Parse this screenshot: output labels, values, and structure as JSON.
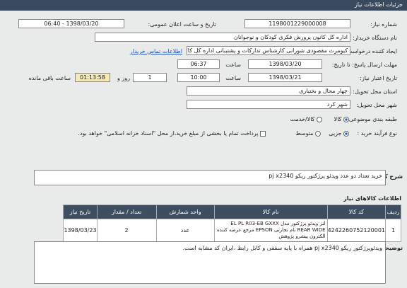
{
  "header": {
    "title": "جزئیات اطلاعات نیاز"
  },
  "labels": {
    "need_no": "شماره نیاز:",
    "public_date": "تاریخ و ساعت اعلان عمومی:",
    "buyer": "نام دستگاه خریدار:",
    "creator": "ایجاد کننده درخواست:",
    "reply_deadline": "مهلت ارسال پاسخ: تا تاریخ:",
    "time": "ساعت",
    "validity": "تاریخ اعتبار نیاز:",
    "day_and": "روز و",
    "remaining": "ساعت باقی مانده",
    "province": "استان محل تحویل:",
    "city": "شهر محل تحویل:",
    "category": "طبقه بندی موضوعی:",
    "process_type": "نوع فرآیند خرید :",
    "contact": "اطلاعات تماس خریدار"
  },
  "values": {
    "need_no": "1198001229000008",
    "public_date": "1398/03/20 - 06:40",
    "buyer": "اداره کل کانون پرورش فکری کودکان و نوجوانان",
    "creator": "کیومرث مقصودی شورانی کارشناس تدارکات و پشتیبانی اداره کل کانون پرورش",
    "reply_date": "1398/03/20",
    "reply_time": "06:37",
    "validity_date": "1398/03/21",
    "validity_time": "10:00",
    "days": "1",
    "remaining": "01:13:58",
    "province": "چهار محال و بختیاری",
    "city": "شهر کرد"
  },
  "category": {
    "options": [
      "کالا",
      "کالا/خدمت"
    ],
    "selected": "کالا"
  },
  "process": {
    "options": [
      "جزیی",
      "متوسط"
    ],
    "selected": "جزیی",
    "note": "پرداخت تمام یا بخشی از مبلغ خرید،از محل \"اسناد خزانه اسلامی\" خواهد بود."
  },
  "general": {
    "title": "شرح کلی نیاز:",
    "text": "خرید تعداد دو عدد ویدئو پرژکتور ریکو pj x2340"
  },
  "goods": {
    "title": "اطلاعات کالاهای نیاز",
    "headers": [
      "ردیف",
      "کد کالا",
      "نام کالا",
      "واحد شمارش",
      "تعداد / مقدار",
      "تاریخ نیاز"
    ],
    "rows": [
      {
        "row": "1",
        "code": "4242260752120001",
        "name": "لنز ویدئو پرژکتور مدل EL PL R03-EB GXXX REAR WIDE نام تجارتی EPSON مرجع عرضه کننده الکترون پیشرو پژوهش",
        "unit": "عدد",
        "qty": "2",
        "date": "1398/03/23"
      }
    ]
  },
  "buyer_notes": {
    "title": "توضیحات خریدار:",
    "text": "ویدئوپرژکتور ریکو pj x2340  همراه با پایه سقفی و کابل رابط ،ایران کد مشابه است."
  }
}
